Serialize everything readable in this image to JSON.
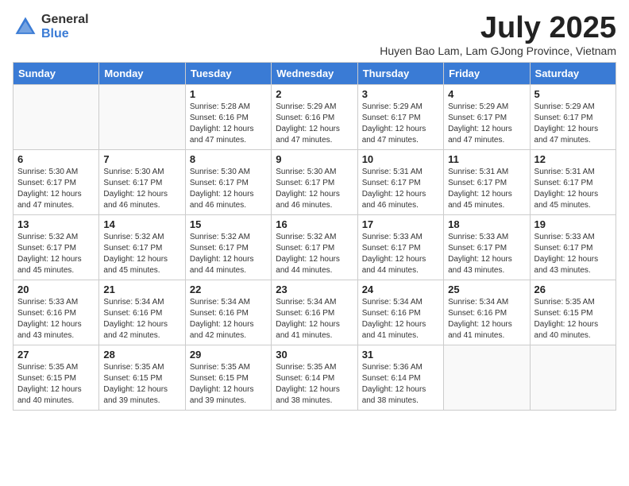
{
  "logo": {
    "line1": "General",
    "line2": "Blue"
  },
  "title": "July 2025",
  "subtitle": "Huyen Bao Lam, Lam GJong Province, Vietnam",
  "days_of_week": [
    "Sunday",
    "Monday",
    "Tuesday",
    "Wednesday",
    "Thursday",
    "Friday",
    "Saturday"
  ],
  "weeks": [
    [
      {
        "day": "",
        "info": ""
      },
      {
        "day": "",
        "info": ""
      },
      {
        "day": "1",
        "info": "Sunrise: 5:28 AM\nSunset: 6:16 PM\nDaylight: 12 hours and 47 minutes."
      },
      {
        "day": "2",
        "info": "Sunrise: 5:29 AM\nSunset: 6:16 PM\nDaylight: 12 hours and 47 minutes."
      },
      {
        "day": "3",
        "info": "Sunrise: 5:29 AM\nSunset: 6:17 PM\nDaylight: 12 hours and 47 minutes."
      },
      {
        "day": "4",
        "info": "Sunrise: 5:29 AM\nSunset: 6:17 PM\nDaylight: 12 hours and 47 minutes."
      },
      {
        "day": "5",
        "info": "Sunrise: 5:29 AM\nSunset: 6:17 PM\nDaylight: 12 hours and 47 minutes."
      }
    ],
    [
      {
        "day": "6",
        "info": "Sunrise: 5:30 AM\nSunset: 6:17 PM\nDaylight: 12 hours and 47 minutes."
      },
      {
        "day": "7",
        "info": "Sunrise: 5:30 AM\nSunset: 6:17 PM\nDaylight: 12 hours and 46 minutes."
      },
      {
        "day": "8",
        "info": "Sunrise: 5:30 AM\nSunset: 6:17 PM\nDaylight: 12 hours and 46 minutes."
      },
      {
        "day": "9",
        "info": "Sunrise: 5:30 AM\nSunset: 6:17 PM\nDaylight: 12 hours and 46 minutes."
      },
      {
        "day": "10",
        "info": "Sunrise: 5:31 AM\nSunset: 6:17 PM\nDaylight: 12 hours and 46 minutes."
      },
      {
        "day": "11",
        "info": "Sunrise: 5:31 AM\nSunset: 6:17 PM\nDaylight: 12 hours and 45 minutes."
      },
      {
        "day": "12",
        "info": "Sunrise: 5:31 AM\nSunset: 6:17 PM\nDaylight: 12 hours and 45 minutes."
      }
    ],
    [
      {
        "day": "13",
        "info": "Sunrise: 5:32 AM\nSunset: 6:17 PM\nDaylight: 12 hours and 45 minutes."
      },
      {
        "day": "14",
        "info": "Sunrise: 5:32 AM\nSunset: 6:17 PM\nDaylight: 12 hours and 45 minutes."
      },
      {
        "day": "15",
        "info": "Sunrise: 5:32 AM\nSunset: 6:17 PM\nDaylight: 12 hours and 44 minutes."
      },
      {
        "day": "16",
        "info": "Sunrise: 5:32 AM\nSunset: 6:17 PM\nDaylight: 12 hours and 44 minutes."
      },
      {
        "day": "17",
        "info": "Sunrise: 5:33 AM\nSunset: 6:17 PM\nDaylight: 12 hours and 44 minutes."
      },
      {
        "day": "18",
        "info": "Sunrise: 5:33 AM\nSunset: 6:17 PM\nDaylight: 12 hours and 43 minutes."
      },
      {
        "day": "19",
        "info": "Sunrise: 5:33 AM\nSunset: 6:17 PM\nDaylight: 12 hours and 43 minutes."
      }
    ],
    [
      {
        "day": "20",
        "info": "Sunrise: 5:33 AM\nSunset: 6:16 PM\nDaylight: 12 hours and 43 minutes."
      },
      {
        "day": "21",
        "info": "Sunrise: 5:34 AM\nSunset: 6:16 PM\nDaylight: 12 hours and 42 minutes."
      },
      {
        "day": "22",
        "info": "Sunrise: 5:34 AM\nSunset: 6:16 PM\nDaylight: 12 hours and 42 minutes."
      },
      {
        "day": "23",
        "info": "Sunrise: 5:34 AM\nSunset: 6:16 PM\nDaylight: 12 hours and 41 minutes."
      },
      {
        "day": "24",
        "info": "Sunrise: 5:34 AM\nSunset: 6:16 PM\nDaylight: 12 hours and 41 minutes."
      },
      {
        "day": "25",
        "info": "Sunrise: 5:34 AM\nSunset: 6:16 PM\nDaylight: 12 hours and 41 minutes."
      },
      {
        "day": "26",
        "info": "Sunrise: 5:35 AM\nSunset: 6:15 PM\nDaylight: 12 hours and 40 minutes."
      }
    ],
    [
      {
        "day": "27",
        "info": "Sunrise: 5:35 AM\nSunset: 6:15 PM\nDaylight: 12 hours and 40 minutes."
      },
      {
        "day": "28",
        "info": "Sunrise: 5:35 AM\nSunset: 6:15 PM\nDaylight: 12 hours and 39 minutes."
      },
      {
        "day": "29",
        "info": "Sunrise: 5:35 AM\nSunset: 6:15 PM\nDaylight: 12 hours and 39 minutes."
      },
      {
        "day": "30",
        "info": "Sunrise: 5:35 AM\nSunset: 6:14 PM\nDaylight: 12 hours and 38 minutes."
      },
      {
        "day": "31",
        "info": "Sunrise: 5:36 AM\nSunset: 6:14 PM\nDaylight: 12 hours and 38 minutes."
      },
      {
        "day": "",
        "info": ""
      },
      {
        "day": "",
        "info": ""
      }
    ]
  ]
}
